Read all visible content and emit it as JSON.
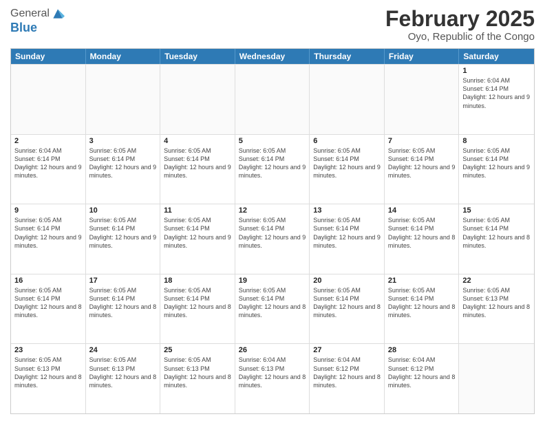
{
  "header": {
    "logo_general": "General",
    "logo_blue": "Blue",
    "month_title": "February 2025",
    "subtitle": "Oyo, Republic of the Congo"
  },
  "calendar": {
    "days_of_week": [
      "Sunday",
      "Monday",
      "Tuesday",
      "Wednesday",
      "Thursday",
      "Friday",
      "Saturday"
    ],
    "rows": [
      [
        {
          "day": "",
          "info": ""
        },
        {
          "day": "",
          "info": ""
        },
        {
          "day": "",
          "info": ""
        },
        {
          "day": "",
          "info": ""
        },
        {
          "day": "",
          "info": ""
        },
        {
          "day": "",
          "info": ""
        },
        {
          "day": "1",
          "info": "Sunrise: 6:04 AM\nSunset: 6:14 PM\nDaylight: 12 hours and 9 minutes."
        }
      ],
      [
        {
          "day": "2",
          "info": "Sunrise: 6:04 AM\nSunset: 6:14 PM\nDaylight: 12 hours and 9 minutes."
        },
        {
          "day": "3",
          "info": "Sunrise: 6:05 AM\nSunset: 6:14 PM\nDaylight: 12 hours and 9 minutes."
        },
        {
          "day": "4",
          "info": "Sunrise: 6:05 AM\nSunset: 6:14 PM\nDaylight: 12 hours and 9 minutes."
        },
        {
          "day": "5",
          "info": "Sunrise: 6:05 AM\nSunset: 6:14 PM\nDaylight: 12 hours and 9 minutes."
        },
        {
          "day": "6",
          "info": "Sunrise: 6:05 AM\nSunset: 6:14 PM\nDaylight: 12 hours and 9 minutes."
        },
        {
          "day": "7",
          "info": "Sunrise: 6:05 AM\nSunset: 6:14 PM\nDaylight: 12 hours and 9 minutes."
        },
        {
          "day": "8",
          "info": "Sunrise: 6:05 AM\nSunset: 6:14 PM\nDaylight: 12 hours and 9 minutes."
        }
      ],
      [
        {
          "day": "9",
          "info": "Sunrise: 6:05 AM\nSunset: 6:14 PM\nDaylight: 12 hours and 9 minutes."
        },
        {
          "day": "10",
          "info": "Sunrise: 6:05 AM\nSunset: 6:14 PM\nDaylight: 12 hours and 9 minutes."
        },
        {
          "day": "11",
          "info": "Sunrise: 6:05 AM\nSunset: 6:14 PM\nDaylight: 12 hours and 9 minutes."
        },
        {
          "day": "12",
          "info": "Sunrise: 6:05 AM\nSunset: 6:14 PM\nDaylight: 12 hours and 9 minutes."
        },
        {
          "day": "13",
          "info": "Sunrise: 6:05 AM\nSunset: 6:14 PM\nDaylight: 12 hours and 9 minutes."
        },
        {
          "day": "14",
          "info": "Sunrise: 6:05 AM\nSunset: 6:14 PM\nDaylight: 12 hours and 8 minutes."
        },
        {
          "day": "15",
          "info": "Sunrise: 6:05 AM\nSunset: 6:14 PM\nDaylight: 12 hours and 8 minutes."
        }
      ],
      [
        {
          "day": "16",
          "info": "Sunrise: 6:05 AM\nSunset: 6:14 PM\nDaylight: 12 hours and 8 minutes."
        },
        {
          "day": "17",
          "info": "Sunrise: 6:05 AM\nSunset: 6:14 PM\nDaylight: 12 hours and 8 minutes."
        },
        {
          "day": "18",
          "info": "Sunrise: 6:05 AM\nSunset: 6:14 PM\nDaylight: 12 hours and 8 minutes."
        },
        {
          "day": "19",
          "info": "Sunrise: 6:05 AM\nSunset: 6:14 PM\nDaylight: 12 hours and 8 minutes."
        },
        {
          "day": "20",
          "info": "Sunrise: 6:05 AM\nSunset: 6:14 PM\nDaylight: 12 hours and 8 minutes."
        },
        {
          "day": "21",
          "info": "Sunrise: 6:05 AM\nSunset: 6:14 PM\nDaylight: 12 hours and 8 minutes."
        },
        {
          "day": "22",
          "info": "Sunrise: 6:05 AM\nSunset: 6:13 PM\nDaylight: 12 hours and 8 minutes."
        }
      ],
      [
        {
          "day": "23",
          "info": "Sunrise: 6:05 AM\nSunset: 6:13 PM\nDaylight: 12 hours and 8 minutes."
        },
        {
          "day": "24",
          "info": "Sunrise: 6:05 AM\nSunset: 6:13 PM\nDaylight: 12 hours and 8 minutes."
        },
        {
          "day": "25",
          "info": "Sunrise: 6:05 AM\nSunset: 6:13 PM\nDaylight: 12 hours and 8 minutes."
        },
        {
          "day": "26",
          "info": "Sunrise: 6:04 AM\nSunset: 6:13 PM\nDaylight: 12 hours and 8 minutes."
        },
        {
          "day": "27",
          "info": "Sunrise: 6:04 AM\nSunset: 6:12 PM\nDaylight: 12 hours and 8 minutes."
        },
        {
          "day": "28",
          "info": "Sunrise: 6:04 AM\nSunset: 6:12 PM\nDaylight: 12 hours and 8 minutes."
        },
        {
          "day": "",
          "info": ""
        }
      ]
    ]
  }
}
